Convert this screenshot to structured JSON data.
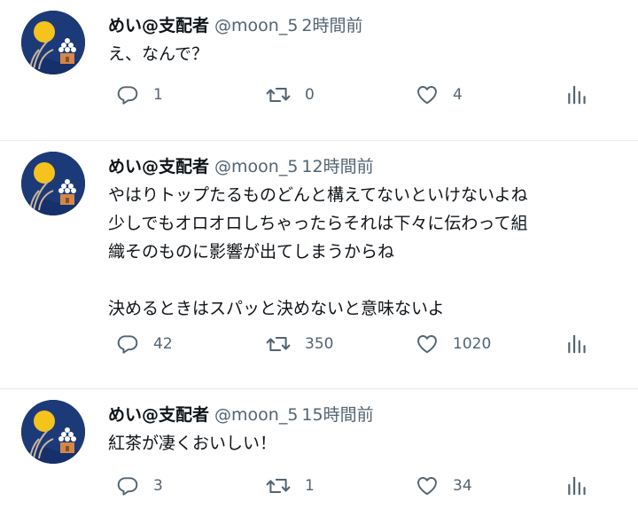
{
  "tweets": [
    {
      "name": "めい@支配者",
      "handle": "@moon_5",
      "time": "2時間前",
      "text": "え、なんで？",
      "reply_count": "1",
      "retweet_count": "0",
      "like_count": "4",
      "icons": [
        "reply-icon",
        "retweet-icon",
        "like-icon",
        "analytics-icon"
      ]
    },
    {
      "name": "めい@支配者",
      "handle": "@moon_5",
      "time": "12時間前",
      "text": "やはりトップたるものどんと構えてないといけないよね\n少しでもオロオロしちゃったらそれは下々に伝わって組\n織そのものに影響が出てしまうからね\n\n決めるときはスパッと決めないと意味ないよ",
      "reply_count": "42",
      "retweet_count": "350",
      "like_count": "1020",
      "icons": [
        "reply-icon",
        "retweet-icon",
        "like-icon",
        "analytics-icon"
      ]
    },
    {
      "name": "めい@支配者",
      "handle": "@moon_5",
      "time": "15時間前",
      "text": "紅茶が凄くおいしい！",
      "reply_count": "3",
      "retweet_count": "1",
      "like_count": "34",
      "icons": [
        "reply-icon",
        "retweet-icon",
        "like-icon",
        "analytics-icon"
      ]
    }
  ],
  "colors": {
    "text": "#0f1419",
    "secondary": "#536471",
    "divider": "#e6ecf0",
    "avatar_bg": "#1d3a78",
    "moon": "#f6c21c"
  }
}
